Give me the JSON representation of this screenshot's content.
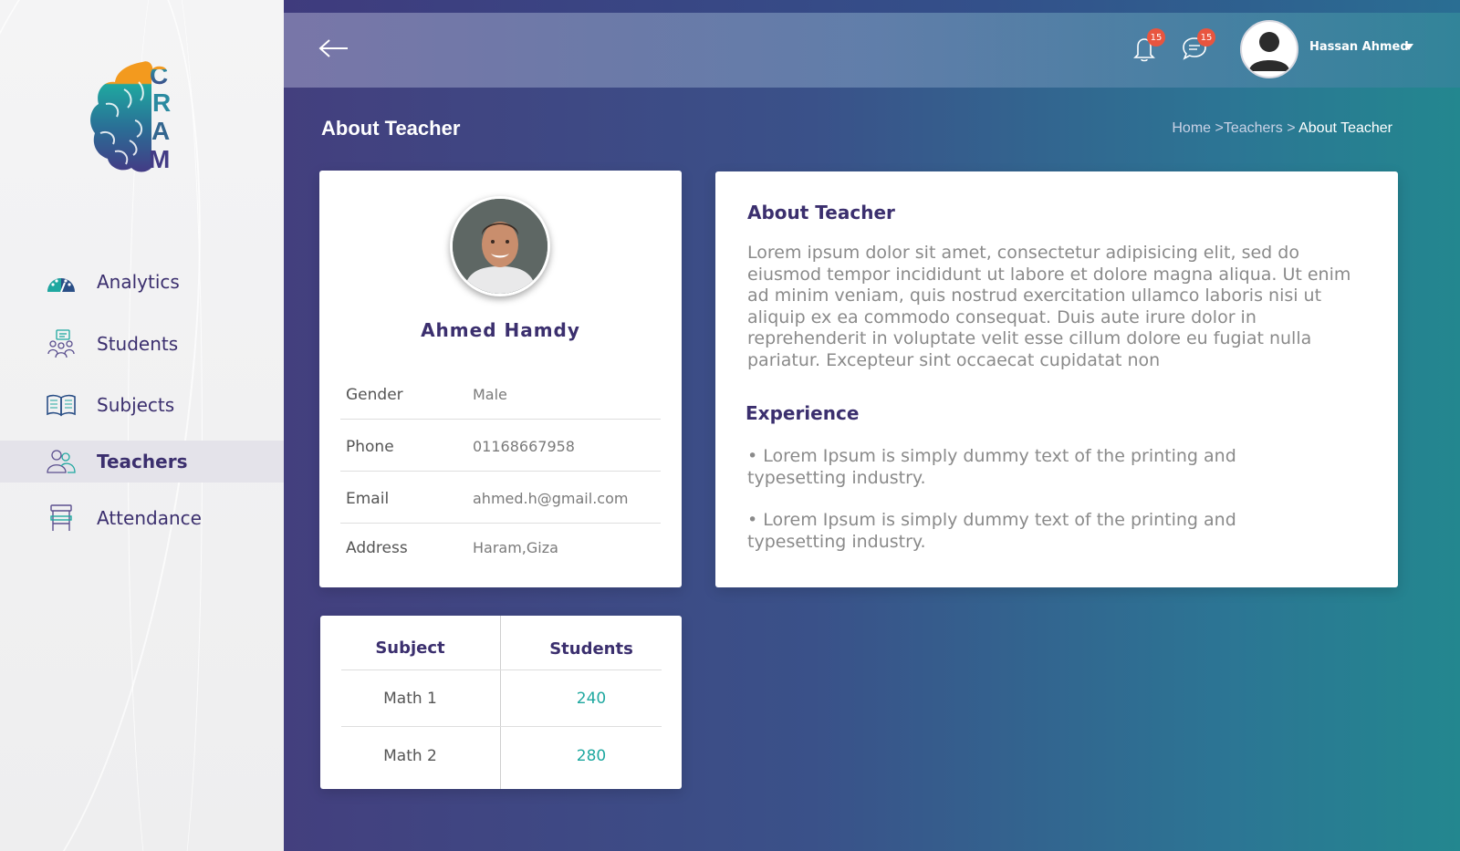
{
  "app": {
    "logo_letters": [
      "C",
      "R",
      "A",
      "M"
    ]
  },
  "sidebar": {
    "items": [
      {
        "label": "Analytics",
        "icon": "analytics-gauge-icon",
        "active": false
      },
      {
        "label": "Students",
        "icon": "students-group-icon",
        "active": false
      },
      {
        "label": "Subjects",
        "icon": "open-book-icon",
        "active": false
      },
      {
        "label": "Teachers",
        "icon": "teachers-icon",
        "active": true
      },
      {
        "label": "Attendance",
        "icon": "desk-chair-icon",
        "active": false
      }
    ]
  },
  "header": {
    "notifications_count": "15",
    "messages_count": "15",
    "user_name": "Hassan Ahmed"
  },
  "page": {
    "title": "About Teacher",
    "breadcrumb": {
      "home": "Home >",
      "teachers": "Teachers >",
      "current": "About Teacher"
    }
  },
  "profile": {
    "name": "Ahmed Hamdy",
    "fields": [
      {
        "key": "Gender",
        "value": "Male"
      },
      {
        "key": "Phone",
        "value": "01168667958"
      },
      {
        "key": "Email",
        "value": "ahmed.h@gmail.com"
      },
      {
        "key": "Address",
        "value": "Haram,Giza"
      }
    ]
  },
  "about": {
    "heading": "About Teacher",
    "text": "Lorem ipsum dolor sit amet, consectetur adipisicing elit, sed do eiusmod tempor incididunt ut labore et dolore magna aliqua. Ut enim ad minim veniam, quis nostrud exercitation ullamco laboris nisi ut aliquip ex ea commodo consequat. Duis aute irure dolor in reprehenderit in voluptate velit esse cillum dolore eu fugiat nulla pariatur. Excepteur sint occaecat cupidatat non",
    "experience_heading": "Experience",
    "experience": [
      "• Lorem Ipsum is simply dummy text of the printing and typesetting industry.",
      "• Lorem Ipsum is simply dummy text of the printing and typesetting industry."
    ]
  },
  "subjects_table": {
    "headers": [
      "Subject",
      "Students"
    ],
    "rows": [
      [
        "Math 1",
        "240"
      ],
      [
        "Math 2",
        "280"
      ]
    ]
  },
  "colors": {
    "primary_text": "#3b2f6e",
    "accent_teal": "#1fa8a0",
    "badge": "#e8553f",
    "logo_orange": "#f39a1e"
  }
}
